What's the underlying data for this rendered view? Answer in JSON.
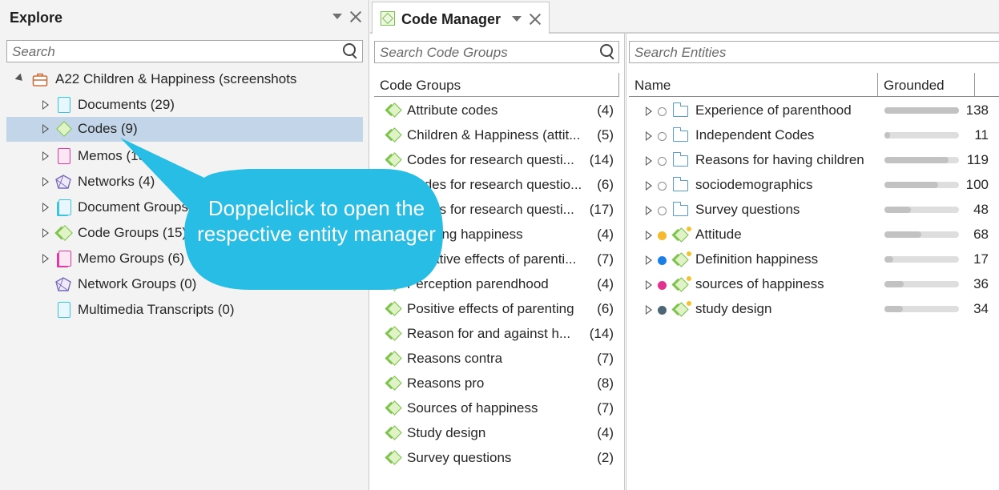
{
  "explore": {
    "title": "Explore",
    "search_placeholder": "Search",
    "project": "A22 Children & Happiness (screenshots",
    "items": [
      {
        "label": "Documents (29)",
        "icon": "document-icon"
      },
      {
        "label": "Codes (9)",
        "icon": "code-icon",
        "selected": true
      },
      {
        "label": "Memos (15)",
        "icon": "memo-icon"
      },
      {
        "label": "Networks (4)",
        "icon": "network-icon"
      },
      {
        "label": "Document Groups (4)",
        "icon": "document-group-icon"
      },
      {
        "label": "Code Groups (15)",
        "icon": "code-group-icon"
      },
      {
        "label": "Memo Groups (6)",
        "icon": "memo-group-icon"
      },
      {
        "label": "Network Groups (0)",
        "icon": "network-group-icon"
      },
      {
        "label": "Multimedia Transcripts (0)",
        "icon": "transcript-icon"
      }
    ]
  },
  "callout": {
    "text": "Doppelclick to open the respective entity manager",
    "color": "#27bde5"
  },
  "code_manager": {
    "tab_title": "Code Manager",
    "groups_search_placeholder": "Search Code Groups",
    "entities_search_placeholder": "Search Entities",
    "groups_header": "Code Groups",
    "groups": [
      {
        "name": "Attribute codes",
        "count": "(4)"
      },
      {
        "name": "Children & Happiness (attit...",
        "count": "(5)"
      },
      {
        "name": "Codes for research questi...",
        "count": "(14)"
      },
      {
        "name": "Codes for research questio...",
        "count": "(6)"
      },
      {
        "name": "Codes for research questi...",
        "count": "(17)"
      },
      {
        "name": "Defining happiness",
        "count": "(4)"
      },
      {
        "name": "Negative effects of parenti...",
        "count": "(7)"
      },
      {
        "name": "Perception parendhood",
        "count": "(4)"
      },
      {
        "name": "Positive effects of parenting",
        "count": "(6)"
      },
      {
        "name": "Reason for and against h...",
        "count": "(14)"
      },
      {
        "name": "Reasons contra",
        "count": "(7)"
      },
      {
        "name": "Reasons pro",
        "count": "(8)"
      },
      {
        "name": "Sources of happiness",
        "count": "(7)"
      },
      {
        "name": "Study design",
        "count": "(4)"
      },
      {
        "name": "Survey questions",
        "count": "(2)"
      }
    ],
    "col_name": "Name",
    "col_grounded": "Grounded",
    "entities": [
      {
        "name": "Experience of parenthood",
        "kind": "folder",
        "dot": "",
        "grounded": "138",
        "fill": 1.0
      },
      {
        "name": "Independent Codes",
        "kind": "folder",
        "dot": "",
        "grounded": "11",
        "fill": 0.08
      },
      {
        "name": "Reasons for having children",
        "kind": "folder",
        "dot": "",
        "grounded": "119",
        "fill": 0.86
      },
      {
        "name": "sociodemographics",
        "kind": "folder",
        "dot": "",
        "grounded": "100",
        "fill": 0.72
      },
      {
        "name": "Survey questions",
        "kind": "folder",
        "dot": "",
        "grounded": "48",
        "fill": 0.35
      },
      {
        "name": "Attitude",
        "kind": "code",
        "dot": "#f5b82e",
        "grounded": "68",
        "fill": 0.49
      },
      {
        "name": "Definition happiness",
        "kind": "code",
        "dot": "#1a7fe6",
        "grounded": "17",
        "fill": 0.12
      },
      {
        "name": "sources of happiness",
        "kind": "code",
        "dot": "#e3318f",
        "grounded": "36",
        "fill": 0.26
      },
      {
        "name": "study design",
        "kind": "code",
        "dot": "#4d6675",
        "grounded": "34",
        "fill": 0.25
      }
    ]
  }
}
